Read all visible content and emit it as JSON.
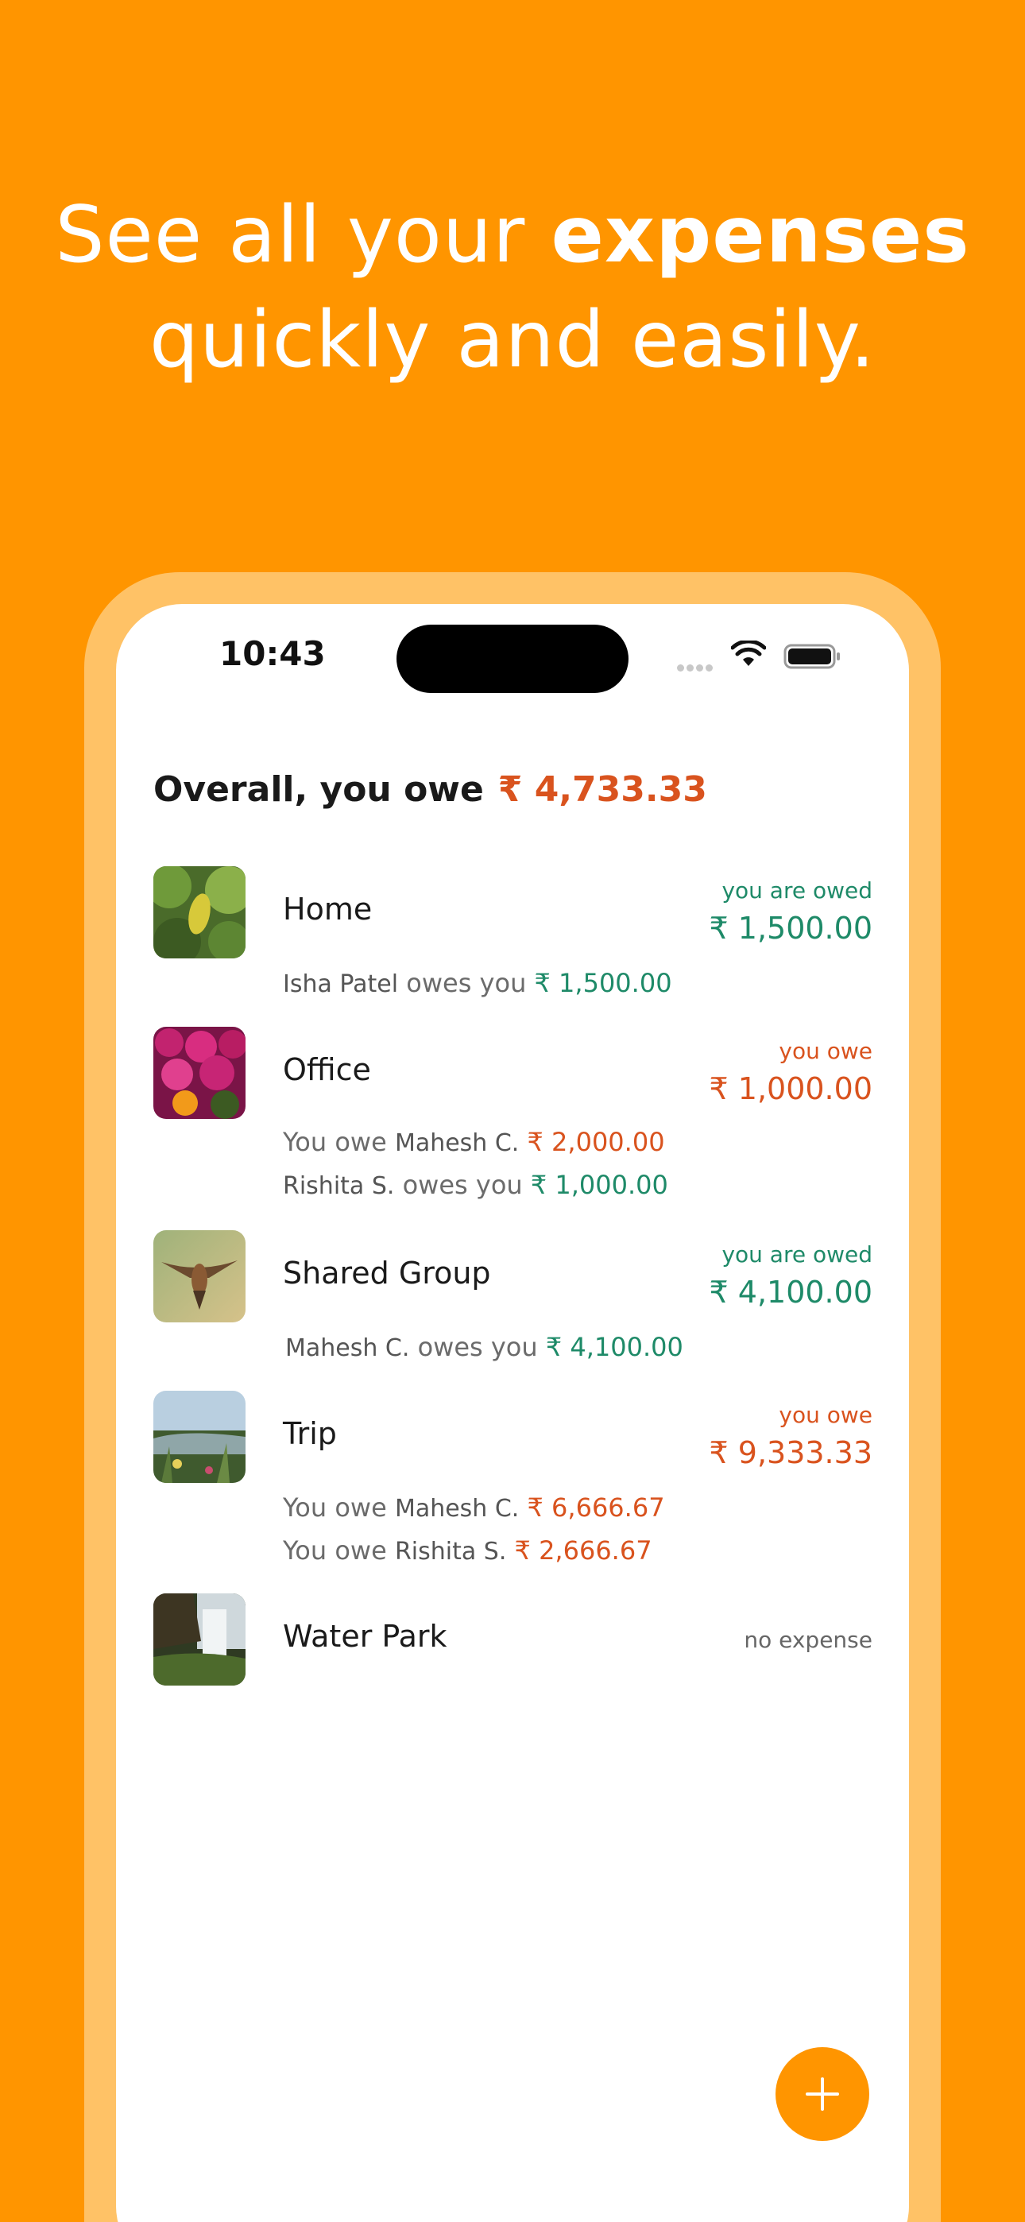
{
  "headline": {
    "line1_prefix": "See all your ",
    "line1_bold": "expenses",
    "line2": "quickly and easily."
  },
  "status_bar": {
    "time": "10:43"
  },
  "summary": {
    "label": "Overall, you owe",
    "amount": "₹ 4,733.33"
  },
  "groups": [
    {
      "name": "Home",
      "status": "you are owed",
      "amount": "₹ 1,500.00",
      "lines": [
        {
          "person": "Isha Patel",
          "text": "owes you",
          "amount": "₹ 1,500.00"
        }
      ]
    },
    {
      "name": "Office",
      "status": "you owe",
      "amount": "₹ 1,000.00",
      "lines": [
        {
          "prefix": "You owe",
          "person": "Mahesh C.",
          "amount": "₹ 2,000.00"
        },
        {
          "person": "Rishita S.",
          "text": "owes you",
          "amount": "₹ 1,000.00"
        }
      ]
    },
    {
      "name": "Shared Group",
      "status": "you are owed",
      "amount": "₹ 4,100.00",
      "lines": [
        {
          "person": "Mahesh C.",
          "text": "owes you",
          "amount": "₹ 4,100.00"
        }
      ]
    },
    {
      "name": "Trip",
      "status": "you owe",
      "amount": "₹ 9,333.33",
      "lines": [
        {
          "prefix": "You owe",
          "person": "Mahesh C.",
          "amount": "₹ 6,666.67"
        },
        {
          "prefix": "You owe",
          "person": "Rishita S.",
          "amount": "₹ 2,666.67"
        }
      ]
    },
    {
      "name": "Water Park",
      "status": "no expense"
    }
  ],
  "colors": {
    "accent": "#FF9500",
    "frame": "#FFC266",
    "owed": "#1E8A68",
    "owe": "#D9531E"
  },
  "icons": {
    "fab": "plus-icon"
  }
}
